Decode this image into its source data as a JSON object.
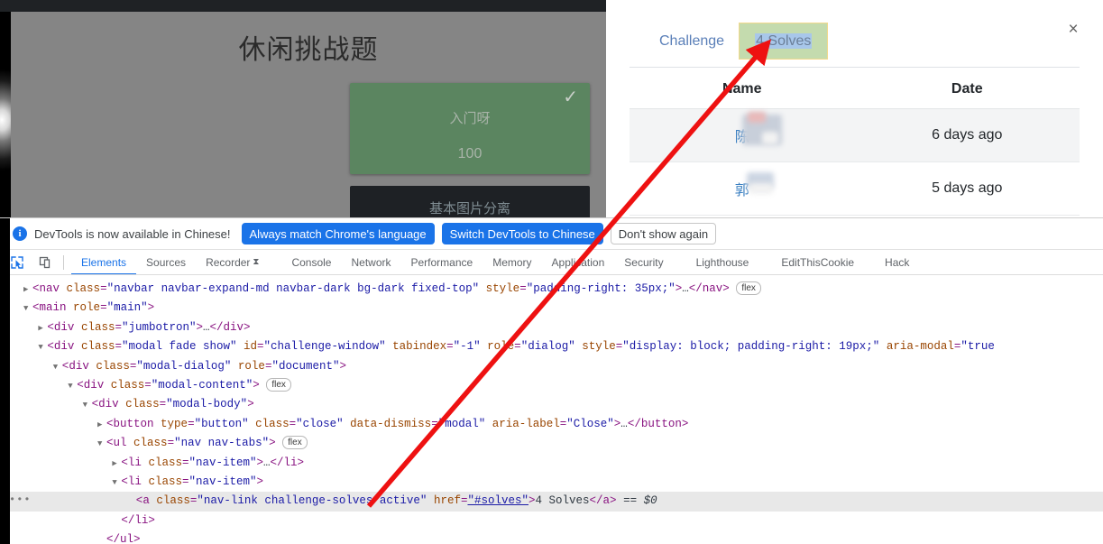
{
  "page": {
    "title": "休闲挑战题",
    "cards": [
      {
        "name": "入门呀",
        "value": "100",
        "solved_icon": "✓",
        "state": "solved"
      },
      {
        "name": "基本图片分离",
        "value": "",
        "state": "unsolved"
      }
    ]
  },
  "modal": {
    "close_label": "×",
    "tabs": [
      {
        "label": "Challenge",
        "active": false
      },
      {
        "label": "4 Solves",
        "active": true,
        "highlighted": true
      }
    ],
    "table": {
      "headers": [
        "Name",
        "Date"
      ],
      "rows": [
        {
          "name": "陈",
          "date": "6 days ago"
        },
        {
          "name": "郭",
          "date": "5 days ago"
        }
      ]
    }
  },
  "devtools": {
    "notification": {
      "icon": "info-icon",
      "message": "DevTools is now available in Chinese!",
      "buttons": [
        {
          "label": "Always match Chrome's language",
          "style": "primary"
        },
        {
          "label": "Switch DevTools to Chinese",
          "style": "primary"
        },
        {
          "label": "Don't show again",
          "style": "secondary"
        }
      ]
    },
    "toolbar": {
      "inspect_icon": "inspect-element-icon",
      "device_icon": "device-toolbar-icon"
    },
    "tabs": [
      {
        "label": "Elements",
        "active": true
      },
      {
        "label": "Sources",
        "active": false
      },
      {
        "label": "Recorder",
        "active": false,
        "badge": "⧗"
      },
      {
        "label": "Console",
        "active": false
      },
      {
        "label": "Network",
        "active": false
      },
      {
        "label": "Performance",
        "active": false
      },
      {
        "label": "Memory",
        "active": false
      },
      {
        "label": "Application",
        "active": false
      },
      {
        "label": "Security",
        "active": false
      },
      {
        "label": "Lighthouse",
        "active": false
      },
      {
        "label": "EditThisCookie",
        "active": false
      },
      {
        "label": "Hack",
        "active": false
      }
    ],
    "dom": {
      "lines": [
        {
          "id": "line-nav",
          "indent": 0,
          "triangle": "▶",
          "selected": false,
          "parts": [
            {
              "t": "punc",
              "v": "<"
            },
            {
              "t": "tag",
              "v": "nav"
            },
            {
              "t": "sp",
              "v": " "
            },
            {
              "t": "attr",
              "v": "class"
            },
            {
              "t": "punc",
              "v": "="
            },
            {
              "t": "val",
              "v": "\"navbar navbar-expand-md navbar-dark bg-dark fixed-top\""
            },
            {
              "t": "sp",
              "v": " "
            },
            {
              "t": "attr",
              "v": "style"
            },
            {
              "t": "punc",
              "v": "="
            },
            {
              "t": "val",
              "v": "\"padding-right: 35px;\""
            },
            {
              "t": "punc",
              "v": ">"
            },
            {
              "t": "txt",
              "v": "…"
            },
            {
              "t": "punc",
              "v": "</"
            },
            {
              "t": "tag",
              "v": "nav"
            },
            {
              "t": "punc",
              "v": ">"
            },
            {
              "t": "flexbadge",
              "v": "flex"
            }
          ]
        },
        {
          "id": "line-main",
          "indent": 0,
          "triangle": "▼",
          "selected": false,
          "parts": [
            {
              "t": "punc",
              "v": "<"
            },
            {
              "t": "tag",
              "v": "main"
            },
            {
              "t": "sp",
              "v": " "
            },
            {
              "t": "attr",
              "v": "role"
            },
            {
              "t": "punc",
              "v": "="
            },
            {
              "t": "val",
              "v": "\"main\""
            },
            {
              "t": "punc",
              "v": ">"
            }
          ]
        },
        {
          "id": "line-jumbotron",
          "indent": 1,
          "triangle": "▶",
          "selected": false,
          "parts": [
            {
              "t": "punc",
              "v": "<"
            },
            {
              "t": "tag",
              "v": "div"
            },
            {
              "t": "sp",
              "v": " "
            },
            {
              "t": "attr",
              "v": "class"
            },
            {
              "t": "punc",
              "v": "="
            },
            {
              "t": "val",
              "v": "\"jumbotron\""
            },
            {
              "t": "punc",
              "v": ">"
            },
            {
              "t": "txt",
              "v": "…"
            },
            {
              "t": "punc",
              "v": "</"
            },
            {
              "t": "tag",
              "v": "div"
            },
            {
              "t": "punc",
              "v": ">"
            }
          ]
        },
        {
          "id": "line-modal",
          "indent": 1,
          "triangle": "▼",
          "selected": false,
          "parts": [
            {
              "t": "punc",
              "v": "<"
            },
            {
              "t": "tag",
              "v": "div"
            },
            {
              "t": "sp",
              "v": " "
            },
            {
              "t": "attr",
              "v": "class"
            },
            {
              "t": "punc",
              "v": "="
            },
            {
              "t": "val",
              "v": "\"modal fade show\""
            },
            {
              "t": "sp",
              "v": " "
            },
            {
              "t": "attr",
              "v": "id"
            },
            {
              "t": "punc",
              "v": "="
            },
            {
              "t": "val",
              "v": "\"challenge-window\""
            },
            {
              "t": "sp",
              "v": " "
            },
            {
              "t": "attr",
              "v": "tabindex"
            },
            {
              "t": "punc",
              "v": "="
            },
            {
              "t": "val",
              "v": "\"-1\""
            },
            {
              "t": "sp",
              "v": " "
            },
            {
              "t": "attr",
              "v": "role"
            },
            {
              "t": "punc",
              "v": "="
            },
            {
              "t": "val",
              "v": "\"dialog\""
            },
            {
              "t": "sp",
              "v": " "
            },
            {
              "t": "attr",
              "v": "style"
            },
            {
              "t": "punc",
              "v": "="
            },
            {
              "t": "val",
              "v": "\"display: block; padding-right: 19px;\""
            },
            {
              "t": "sp",
              "v": " "
            },
            {
              "t": "attr",
              "v": "aria-modal"
            },
            {
              "t": "punc",
              "v": "="
            },
            {
              "t": "val",
              "v": "\"true"
            }
          ]
        },
        {
          "id": "line-modal-dialog",
          "indent": 2,
          "triangle": "▼",
          "selected": false,
          "parts": [
            {
              "t": "punc",
              "v": "<"
            },
            {
              "t": "tag",
              "v": "div"
            },
            {
              "t": "sp",
              "v": " "
            },
            {
              "t": "attr",
              "v": "class"
            },
            {
              "t": "punc",
              "v": "="
            },
            {
              "t": "val",
              "v": "\"modal-dialog\""
            },
            {
              "t": "sp",
              "v": " "
            },
            {
              "t": "attr",
              "v": "role"
            },
            {
              "t": "punc",
              "v": "="
            },
            {
              "t": "val",
              "v": "\"document\""
            },
            {
              "t": "punc",
              "v": ">"
            }
          ]
        },
        {
          "id": "line-modal-content",
          "indent": 3,
          "triangle": "▼",
          "selected": false,
          "parts": [
            {
              "t": "punc",
              "v": "<"
            },
            {
              "t": "tag",
              "v": "div"
            },
            {
              "t": "sp",
              "v": " "
            },
            {
              "t": "attr",
              "v": "class"
            },
            {
              "t": "punc",
              "v": "="
            },
            {
              "t": "val",
              "v": "\"modal-content\""
            },
            {
              "t": "punc",
              "v": ">"
            },
            {
              "t": "flexbadge",
              "v": "flex"
            }
          ]
        },
        {
          "id": "line-modal-body",
          "indent": 4,
          "triangle": "▼",
          "selected": false,
          "parts": [
            {
              "t": "punc",
              "v": "<"
            },
            {
              "t": "tag",
              "v": "div"
            },
            {
              "t": "sp",
              "v": " "
            },
            {
              "t": "attr",
              "v": "class"
            },
            {
              "t": "punc",
              "v": "="
            },
            {
              "t": "val",
              "v": "\"modal-body\""
            },
            {
              "t": "punc",
              "v": ">"
            }
          ]
        },
        {
          "id": "line-close-button",
          "indent": 5,
          "triangle": "▶",
          "selected": false,
          "parts": [
            {
              "t": "punc",
              "v": "<"
            },
            {
              "t": "tag",
              "v": "button"
            },
            {
              "t": "sp",
              "v": " "
            },
            {
              "t": "attr",
              "v": "type"
            },
            {
              "t": "punc",
              "v": "="
            },
            {
              "t": "val",
              "v": "\"button\""
            },
            {
              "t": "sp",
              "v": " "
            },
            {
              "t": "attr",
              "v": "class"
            },
            {
              "t": "punc",
              "v": "="
            },
            {
              "t": "val",
              "v": "\"close\""
            },
            {
              "t": "sp",
              "v": " "
            },
            {
              "t": "attr",
              "v": "data-dismiss"
            },
            {
              "t": "punc",
              "v": "="
            },
            {
              "t": "val",
              "v": "\"modal\""
            },
            {
              "t": "sp",
              "v": " "
            },
            {
              "t": "attr",
              "v": "aria-label"
            },
            {
              "t": "punc",
              "v": "="
            },
            {
              "t": "val",
              "v": "\"Close\""
            },
            {
              "t": "punc",
              "v": ">"
            },
            {
              "t": "txt",
              "v": "…"
            },
            {
              "t": "punc",
              "v": "</"
            },
            {
              "t": "tag",
              "v": "button"
            },
            {
              "t": "punc",
              "v": ">"
            }
          ]
        },
        {
          "id": "line-ul-navtabs",
          "indent": 5,
          "triangle": "▼",
          "selected": false,
          "parts": [
            {
              "t": "punc",
              "v": "<"
            },
            {
              "t": "tag",
              "v": "ul"
            },
            {
              "t": "sp",
              "v": " "
            },
            {
              "t": "attr",
              "v": "class"
            },
            {
              "t": "punc",
              "v": "="
            },
            {
              "t": "val",
              "v": "\"nav nav-tabs\""
            },
            {
              "t": "punc",
              "v": ">"
            },
            {
              "t": "flexbadge",
              "v": "flex"
            }
          ]
        },
        {
          "id": "line-li-1",
          "indent": 6,
          "triangle": "▶",
          "selected": false,
          "parts": [
            {
              "t": "punc",
              "v": "<"
            },
            {
              "t": "tag",
              "v": "li"
            },
            {
              "t": "sp",
              "v": " "
            },
            {
              "t": "attr",
              "v": "class"
            },
            {
              "t": "punc",
              "v": "="
            },
            {
              "t": "val",
              "v": "\"nav-item\""
            },
            {
              "t": "punc",
              "v": ">"
            },
            {
              "t": "txt",
              "v": "…"
            },
            {
              "t": "punc",
              "v": "</"
            },
            {
              "t": "tag",
              "v": "li"
            },
            {
              "t": "punc",
              "v": ">"
            }
          ]
        },
        {
          "id": "line-li-2",
          "indent": 6,
          "triangle": "▼",
          "selected": false,
          "parts": [
            {
              "t": "punc",
              "v": "<"
            },
            {
              "t": "tag",
              "v": "li"
            },
            {
              "t": "sp",
              "v": " "
            },
            {
              "t": "attr",
              "v": "class"
            },
            {
              "t": "punc",
              "v": "="
            },
            {
              "t": "val",
              "v": "\"nav-item\""
            },
            {
              "t": "punc",
              "v": ">"
            }
          ]
        },
        {
          "id": "line-a-solves",
          "indent": 7,
          "triangle": "",
          "selected": true,
          "dots": "•••",
          "parts": [
            {
              "t": "punc",
              "v": "<"
            },
            {
              "t": "tag",
              "v": "a"
            },
            {
              "t": "sp",
              "v": " "
            },
            {
              "t": "attr",
              "v": "class"
            },
            {
              "t": "punc",
              "v": "="
            },
            {
              "t": "val",
              "v": "\"nav-link challenge-solves active\""
            },
            {
              "t": "sp",
              "v": " "
            },
            {
              "t": "attr",
              "v": "href"
            },
            {
              "t": "punc",
              "v": "="
            },
            {
              "t": "lnk",
              "v": "\"#solves\""
            },
            {
              "t": "punc",
              "v": ">"
            },
            {
              "t": "txt",
              "v": "4 Solves"
            },
            {
              "t": "punc",
              "v": "</"
            },
            {
              "t": "tag",
              "v": "a"
            },
            {
              "t": "punc",
              "v": ">"
            },
            {
              "t": "txt",
              "v": " == "
            },
            {
              "t": "dollar",
              "v": "$0"
            }
          ]
        },
        {
          "id": "line-close-li",
          "indent": 6,
          "triangle": "",
          "selected": false,
          "parts": [
            {
              "t": "punc",
              "v": "</"
            },
            {
              "t": "tag",
              "v": "li"
            },
            {
              "t": "punc",
              "v": ">"
            }
          ]
        },
        {
          "id": "line-close-ul",
          "indent": 5,
          "triangle": "",
          "selected": false,
          "parts": [
            {
              "t": "punc",
              "v": "</"
            },
            {
              "t": "tag",
              "v": "ul"
            },
            {
              "t": "punc",
              "v": ">"
            }
          ]
        }
      ]
    }
  }
}
